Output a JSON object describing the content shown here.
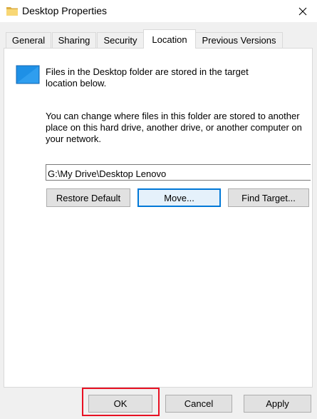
{
  "window": {
    "title": "Desktop Properties",
    "title_icon": "folder-icon",
    "close_icon": "close-icon"
  },
  "tabs": [
    {
      "label": "General",
      "active": false
    },
    {
      "label": "Sharing",
      "active": false
    },
    {
      "label": "Security",
      "active": false
    },
    {
      "label": "Location",
      "active": true
    },
    {
      "label": "Previous Versions",
      "active": false
    }
  ],
  "location": {
    "folder_icon": "desktop-folder-icon",
    "info_lines": [
      "Files in the Desktop folder are stored in the target",
      "location below."
    ],
    "change_lines": [
      "You can change where files in this folder are stored to another",
      "place on this hard drive, another drive, or another computer on",
      "your network."
    ],
    "path_value": "G:\\My Drive\\Desktop Lenovo",
    "restore_label": "Restore Default",
    "move_label": "Move...",
    "find_label": "Find Target..."
  },
  "footer": {
    "ok_label": "OK",
    "cancel_label": "Cancel",
    "apply_label": "Apply"
  },
  "colors": {
    "accent": "#0078d7",
    "highlight": "#e81123",
    "folder_blue": "#1e90e6",
    "folder_yellow": "#f8d775"
  }
}
